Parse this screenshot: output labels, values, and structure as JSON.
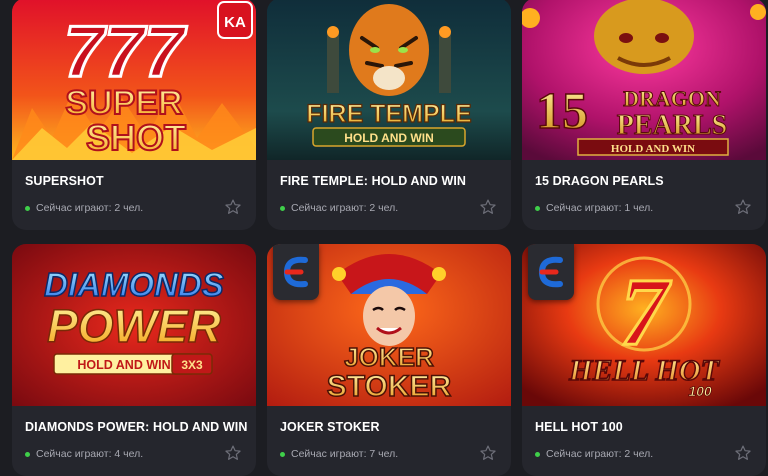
{
  "games": [
    {
      "title": "SUPERSHOT",
      "status": "Сейчас играют: 2 чел.",
      "art_line1": "777",
      "art_line2": "SUPER",
      "art_line3": "SHOT",
      "badge": "KA"
    },
    {
      "title": "FIRE TEMPLE: HOLD AND WIN",
      "status": "Сейчас играют: 2 чел.",
      "art_line1": "FIRE TEMPLE",
      "art_line2": "HOLD AND WIN"
    },
    {
      "title": "15 DRAGON PEARLS",
      "status": "Сейчас играют: 1 чел.",
      "art_line1": "15",
      "art_line2": "DRAGON",
      "art_line3": "PEARLS",
      "art_line4": "HOLD AND WIN"
    },
    {
      "title": "DIAMONDS POWER: HOLD AND WIN",
      "status": "Сейчас играют: 4 чел.",
      "art_line1": "DIAMONDS",
      "art_line2": "POWER",
      "art_line3": "HOLD AND WIN",
      "art_line4": "3X3"
    },
    {
      "title": "JOKER STOKER",
      "status": "Сейчас играют: 7 чел.",
      "art_line1": "JOKER",
      "art_line2": "STOKER"
    },
    {
      "title": "HELL HOT 100",
      "status": "Сейчас играют: 2 чел.",
      "art_line1": "7",
      "art_line2": "HELL HOT",
      "art_line3": "100"
    }
  ],
  "icons": {
    "online": "online-dot-icon",
    "favorite": "star-icon",
    "provider": "provider-logo-icon"
  },
  "colors": {
    "background": "#1c1d22",
    "card": "#25262d",
    "online": "#3fcf4a",
    "text_muted": "#a8a9b2"
  }
}
